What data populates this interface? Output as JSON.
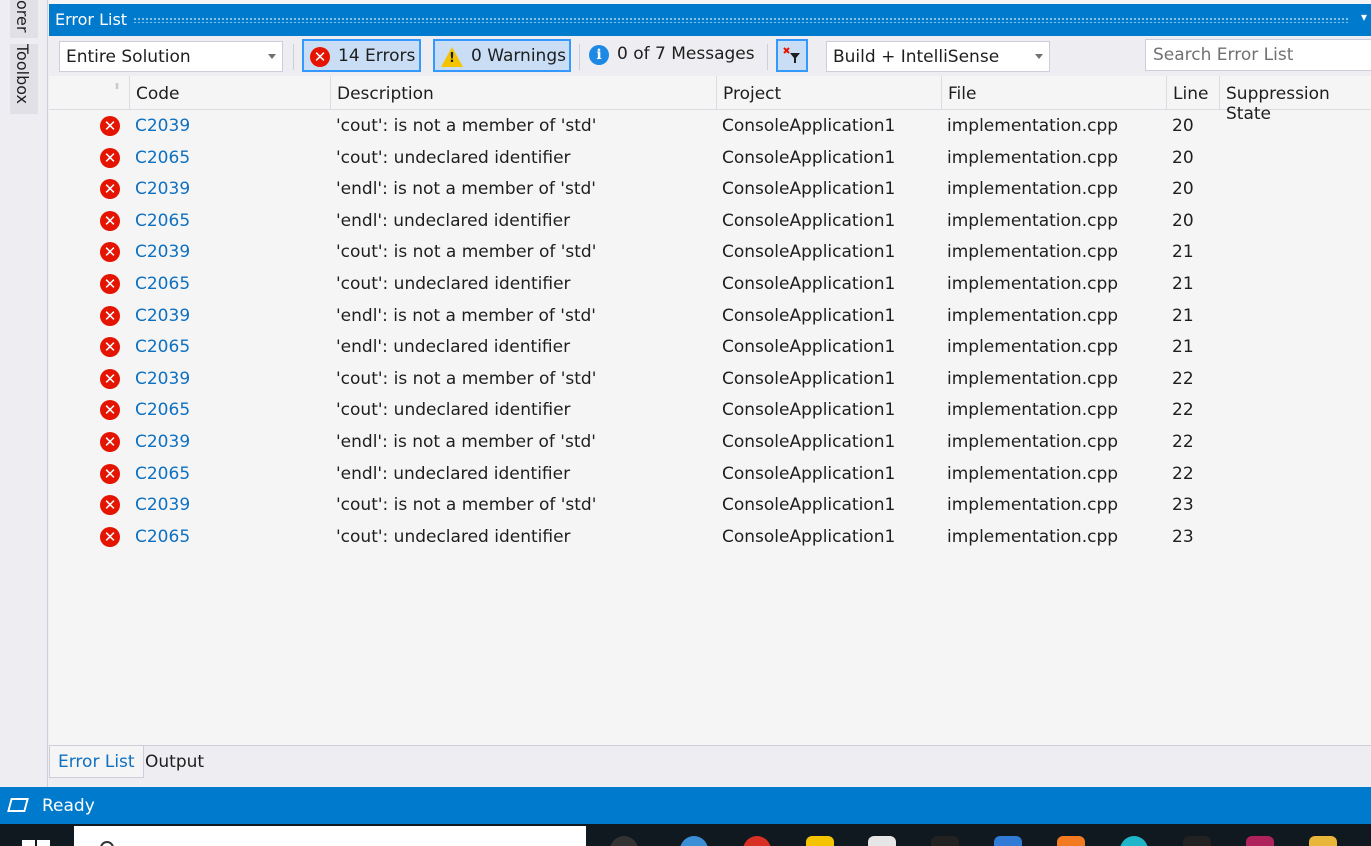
{
  "side_tabs": [
    "orer",
    "Toolbox"
  ],
  "panel": {
    "title": "Error List"
  },
  "toolbar": {
    "scope": "Entire Solution",
    "errors": "14 Errors",
    "warnings": "0 Warnings",
    "messages": "0 of 7 Messages",
    "source": "Build + IntelliSense",
    "search_placeholder": "Search Error List"
  },
  "columns": {
    "code": "Code",
    "description": "Description",
    "project": "Project",
    "file": "File",
    "line": "Line",
    "suppression": "Suppression State"
  },
  "rows": [
    {
      "code": "C2039",
      "description": "'cout': is not a member of 'std'",
      "project": "ConsoleApplication1",
      "file": "implementation.cpp",
      "line": "20"
    },
    {
      "code": "C2065",
      "description": "'cout': undeclared identifier",
      "project": "ConsoleApplication1",
      "file": "implementation.cpp",
      "line": "20"
    },
    {
      "code": "C2039",
      "description": "'endl': is not a member of 'std'",
      "project": "ConsoleApplication1",
      "file": "implementation.cpp",
      "line": "20"
    },
    {
      "code": "C2065",
      "description": "'endl': undeclared identifier",
      "project": "ConsoleApplication1",
      "file": "implementation.cpp",
      "line": "20"
    },
    {
      "code": "C2039",
      "description": "'cout': is not a member of 'std'",
      "project": "ConsoleApplication1",
      "file": "implementation.cpp",
      "line": "21"
    },
    {
      "code": "C2065",
      "description": "'cout': undeclared identifier",
      "project": "ConsoleApplication1",
      "file": "implementation.cpp",
      "line": "21"
    },
    {
      "code": "C2039",
      "description": "'endl': is not a member of 'std'",
      "project": "ConsoleApplication1",
      "file": "implementation.cpp",
      "line": "21"
    },
    {
      "code": "C2065",
      "description": "'endl': undeclared identifier",
      "project": "ConsoleApplication1",
      "file": "implementation.cpp",
      "line": "21"
    },
    {
      "code": "C2039",
      "description": "'cout': is not a member of 'std'",
      "project": "ConsoleApplication1",
      "file": "implementation.cpp",
      "line": "22"
    },
    {
      "code": "C2065",
      "description": "'cout': undeclared identifier",
      "project": "ConsoleApplication1",
      "file": "implementation.cpp",
      "line": "22"
    },
    {
      "code": "C2039",
      "description": "'endl': is not a member of 'std'",
      "project": "ConsoleApplication1",
      "file": "implementation.cpp",
      "line": "22"
    },
    {
      "code": "C2065",
      "description": "'endl': undeclared identifier",
      "project": "ConsoleApplication1",
      "file": "implementation.cpp",
      "line": "22"
    },
    {
      "code": "C2039",
      "description": "'cout': is not a member of 'std'",
      "project": "ConsoleApplication1",
      "file": "implementation.cpp",
      "line": "23"
    },
    {
      "code": "C2065",
      "description": "'cout': undeclared identifier",
      "project": "ConsoleApplication1",
      "file": "implementation.cpp",
      "line": "23"
    }
  ],
  "bottom_tabs": [
    "Error List",
    "Output"
  ],
  "status": {
    "text": "Ready"
  },
  "icons": {
    "error": "error-icon",
    "warning": "warning-icon",
    "info": "info-icon",
    "filter": "filter-icon"
  },
  "colors": {
    "accent": "#007acc",
    "error": "#e51400",
    "link": "#0e70c0",
    "warning": "#f5c400",
    "info": "#1e88e5"
  }
}
